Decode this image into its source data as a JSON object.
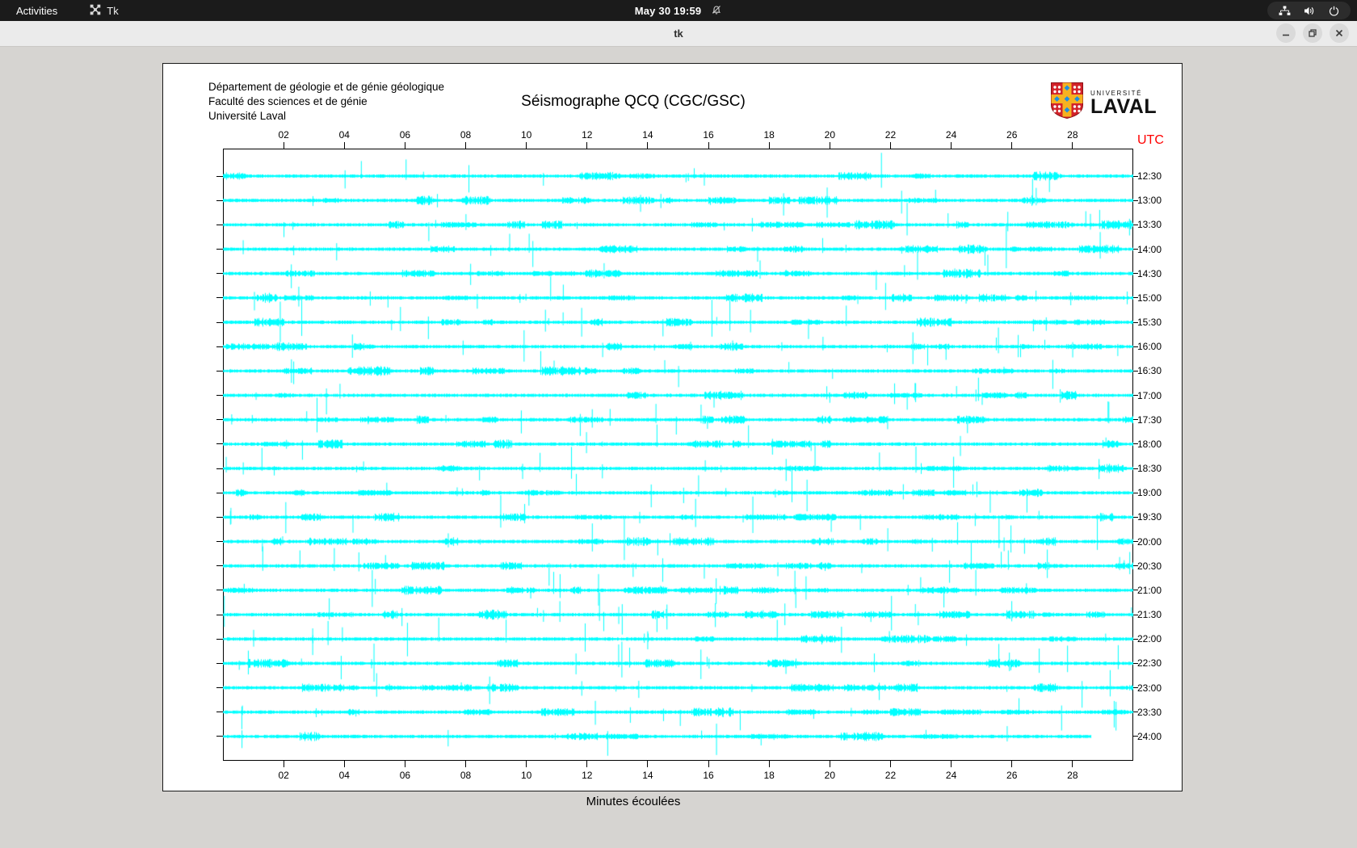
{
  "topbar": {
    "activities_label": "Activities",
    "app_label": "Tk",
    "clock": "May 30 19:59"
  },
  "titlebar": {
    "title": "tk"
  },
  "header": {
    "dept_lines": [
      "Département de géologie et de génie géologique",
      "Faculté des sciences et de génie",
      "Université Laval"
    ],
    "logo_small": "UNIVERSITÉ",
    "logo_big": "LAVAL"
  },
  "chart_data": {
    "type": "seismograph-helicorder",
    "title": "Séismographe QCQ (CGC/GSC)",
    "xlabel": "Minutes écoulées",
    "right_axis_title": "UTC",
    "x_ticks": [
      "02",
      "04",
      "06",
      "08",
      "10",
      "12",
      "14",
      "16",
      "18",
      "20",
      "22",
      "24",
      "26",
      "28"
    ],
    "x_range_minutes": [
      0,
      30
    ],
    "rows": [
      "12:30",
      "13:00",
      "13:30",
      "14:00",
      "14:30",
      "15:00",
      "15:30",
      "16:00",
      "16:30",
      "17:00",
      "17:30",
      "18:00",
      "18:30",
      "19:00",
      "19:30",
      "20:00",
      "20:30",
      "21:00",
      "21:30",
      "22:00",
      "22:30",
      "23:00",
      "23:30",
      "24:00"
    ],
    "last_row_end_minute": 28.6,
    "trace_color": "#00ffff",
    "utc_color": "#ff0000",
    "grid": "off",
    "legend": "none"
  }
}
